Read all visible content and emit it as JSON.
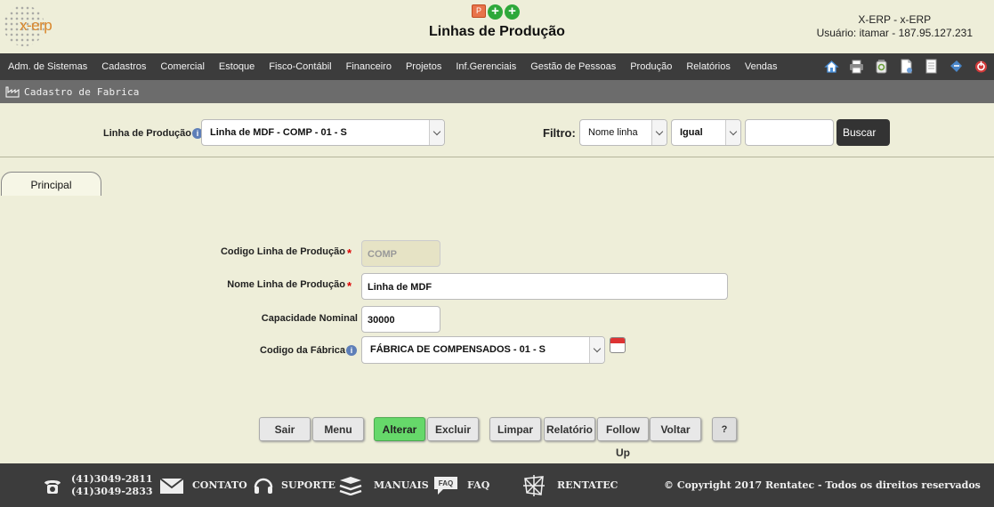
{
  "header": {
    "logo_text": "x-erp",
    "title": "Linhas de Produção",
    "user_line1": "X-ERP - x-ERP",
    "user_line2": "Usuário: itamar - 187.95.127.231"
  },
  "menu": {
    "items": [
      "Adm. de Sistemas",
      "Cadastros",
      "Comercial",
      "Estoque",
      "Fisco-Contábil",
      "Financeiro",
      "Projetos",
      "Inf.Gerenciais",
      "Gestão de Pessoas",
      "Produção",
      "Relatórios",
      "Vendas"
    ],
    "tools": [
      {
        "name": "home-icon",
        "color": "#4a90d9"
      },
      {
        "name": "print-icon",
        "color": "#555555"
      },
      {
        "name": "recycle-icon",
        "color": "#7aa04a"
      },
      {
        "name": "new-document-icon",
        "color": "#6fa0d8"
      },
      {
        "name": "document-icon",
        "color": "#dddddd"
      },
      {
        "name": "export-icon",
        "color": "#4a86c8"
      },
      {
        "name": "power-icon",
        "color": "#d33a3a"
      }
    ]
  },
  "subbar": {
    "label": "Cadastro de Fabrica"
  },
  "filter": {
    "linha_label": "Linha de Produção",
    "linha_value": "Linha de MDF - COMP - 01 - S",
    "filtro_label": "Filtro:",
    "field_value": "Nome linha",
    "operator_value": "Igual",
    "search_value": "",
    "buscar_label": "Buscar"
  },
  "tabs": {
    "principal": "Principal"
  },
  "form": {
    "codigo_label": "Codigo Linha de Produção",
    "codigo_value": "COMP",
    "nome_label": "Nome Linha de Produção",
    "nome_value": "Linha de MDF",
    "capacidade_label": "Capacidade Nominal",
    "capacidade_value": "30000",
    "fabrica_label": "Codigo da Fábrica",
    "fabrica_value": "FÁBRICA DE COMPENSADOS - 01 - S"
  },
  "actions": {
    "sair": "Sair",
    "menu": "Menu",
    "alterar": "Alterar",
    "excluir": "Excluir",
    "limpar": "Limpar",
    "relatorio": "Relatório",
    "followup": "Follow Up",
    "voltar": "Voltar",
    "help": "?"
  },
  "footer": {
    "phone1": "(41)3049-2811",
    "phone2": "(41)3049-2833",
    "contato": "CONTATO",
    "suporte": "SUPORTE",
    "manuais": "MANUAIS",
    "faq": "FAQ",
    "faq_icon_text": "FAQ",
    "rentatec": "RENTATEC",
    "copyright": "© Copyright 2017 Rentatec - Todos os direitos reservados"
  },
  "info_icon_text": "i",
  "ppt_icon_text": "P",
  "plus_icon_text": "+"
}
